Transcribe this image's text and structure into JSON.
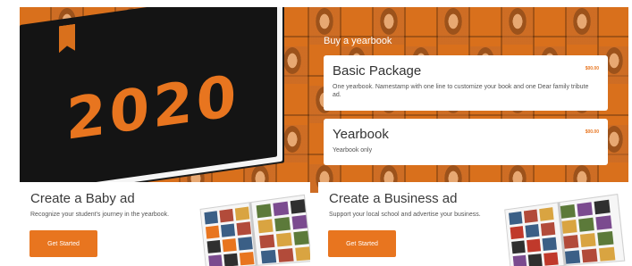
{
  "hero": {
    "year": "2020",
    "buy_heading": "Buy a yearbook"
  },
  "packages": [
    {
      "name": "Basic Package",
      "price": "$00.00",
      "description": "One yearbook. Namestamp with one line to customize your book and one Dear family tribute ad."
    },
    {
      "name": "Yearbook",
      "price": "$00.00",
      "description": "Yearbook only"
    }
  ],
  "ads": [
    {
      "title": "Create a Baby ad",
      "description": "Recognize your student's journey in the yearbook.",
      "cta": "Get Started"
    },
    {
      "title": "Create a Business ad",
      "description": "Support your local school and advertise your business.",
      "cta": "Get Started"
    }
  ],
  "colors": {
    "accent": "#e8751f",
    "hero_background": "#d9701c",
    "book": "#141414"
  },
  "icons": [
    "bookmark-ribbon-icon"
  ]
}
